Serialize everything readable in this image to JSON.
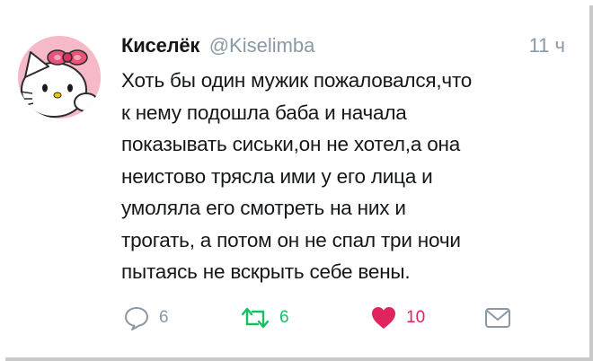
{
  "tweet": {
    "author_name": "Киселёк",
    "handle": "@Kiselimba",
    "time": "11 ч",
    "lines": [
      "Хоть бы один мужик пожаловался,что",
      "к нему подошла баба и начала",
      "показывать сиськи,он не хотел,а она",
      "неистово трясла ими у его лица и",
      "умоляла его смотреть на них и",
      "трогать, а потом он не спал три ночи",
      "пытаясь не вскрыть себе вены."
    ],
    "actions": {
      "reply_count": "6",
      "retweet_count": "6",
      "like_count": "10"
    },
    "icons": {
      "avatar": "hello-kitty-avatar",
      "reply": "reply-icon",
      "retweet": "retweet-icon",
      "like": "heart-icon",
      "dm": "envelope-icon"
    },
    "colors": {
      "retweet_active": "#17bf63",
      "like_active": "#e0245e",
      "muted": "#8b98a5",
      "text": "#14171a",
      "avatar_bg": "#f6b9c8"
    }
  }
}
